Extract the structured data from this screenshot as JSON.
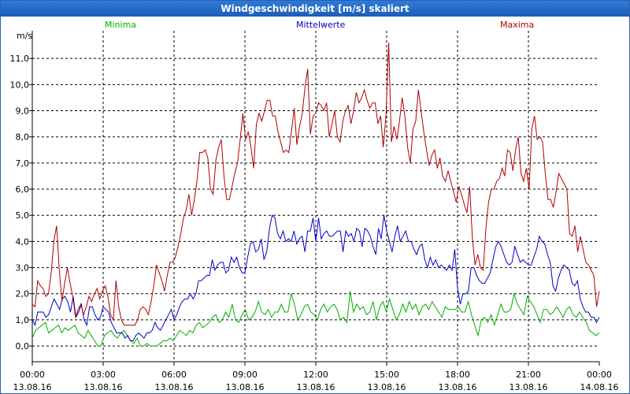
{
  "window": {
    "title": "Windgeschwindigkeit [m/s] skaliert"
  },
  "colors": {
    "minima": "#00b000",
    "mittel": "#0000cc",
    "maxima": "#b00000",
    "titlebar": "#1f62c0"
  },
  "chart_data": {
    "type": "line",
    "ylabel": "m/s",
    "ylim": [
      -0.6,
      12
    ],
    "grid": true,
    "legend_placement": "top",
    "yticks": [
      {
        "v": 0,
        "label": "0,0"
      },
      {
        "v": 1,
        "label": "1,0"
      },
      {
        "v": 2,
        "label": "2,0"
      },
      {
        "v": 3,
        "label": "3,0"
      },
      {
        "v": 4,
        "label": "4,0"
      },
      {
        "v": 5,
        "label": "5,0"
      },
      {
        "v": 6,
        "label": "6,0"
      },
      {
        "v": 7,
        "label": "7,0"
      },
      {
        "v": 8,
        "label": "8,0"
      },
      {
        "v": 9,
        "label": "9,0"
      },
      {
        "v": 10,
        "label": "10,0"
      },
      {
        "v": 11,
        "label": "11,0"
      }
    ],
    "xticks": [
      {
        "h": 0,
        "time": "00:00",
        "date": "13.08.16"
      },
      {
        "h": 3,
        "time": "03:00",
        "date": "13.08.16"
      },
      {
        "h": 6,
        "time": "06:00",
        "date": "13.08.16"
      },
      {
        "h": 9,
        "time": "09:00",
        "date": "13.08.16"
      },
      {
        "h": 12,
        "time": "12:00",
        "date": "13.08.16"
      },
      {
        "h": 15,
        "time": "15:00",
        "date": "13.08.16"
      },
      {
        "h": 18,
        "time": "18:00",
        "date": "13.08.16"
      },
      {
        "h": 21,
        "time": "21:00",
        "date": "13.08.16"
      },
      {
        "h": 24,
        "time": "00:00",
        "date": "14.08.16"
      }
    ],
    "x_hours_step": 0.1667,
    "series": [
      {
        "name": "Minima",
        "color": "#00b000",
        "values": [
          0.3,
          0.6,
          0.7,
          0.8,
          0.9,
          0.5,
          0.6,
          0.7,
          0.8,
          0.5,
          0.7,
          0.6,
          0.7,
          0.8,
          0.5,
          0.4,
          0.3,
          0.6,
          0.4,
          0.2,
          0.0,
          0.0,
          0.4,
          0.5,
          0.6,
          0.4,
          0.3,
          0.5,
          0.6,
          0.4,
          0.2,
          0.1,
          0.3,
          0.0,
          0.0,
          0.1,
          0.0,
          0.0,
          0.0,
          0.1,
          0.2,
          0.2,
          0.3,
          0.2,
          0.4,
          0.6,
          0.5,
          0.4,
          0.6,
          0.5,
          0.8,
          0.9,
          0.7,
          0.8,
          0.9,
          1.1,
          1.2,
          0.9,
          1.0,
          1.3,
          1.1,
          1.6,
          1.0,
          0.9,
          1.2,
          1.4,
          1.0,
          1.1,
          1.3,
          1.7,
          1.3,
          1.2,
          1.4,
          1.1,
          1.3,
          1.3,
          1.6,
          1.3,
          1.3,
          2.0,
          1.6,
          1.0,
          1.2,
          1.5,
          1.6,
          1.3,
          1.2,
          1.0,
          1.4,
          1.6,
          1.3,
          1.5,
          1.6,
          1.4,
          1.0,
          1.1,
          0.9,
          2.1,
          1.3,
          1.6,
          1.4,
          1.5,
          1.2,
          1.3,
          1.7,
          1.0,
          1.5,
          1.7,
          1.3,
          1.8,
          1.4,
          1.0,
          1.2,
          1.6,
          1.3,
          1.7,
          1.4,
          1.6,
          1.2,
          1.5,
          1.6,
          1.4,
          1.7,
          1.5,
          1.3,
          1.1,
          1.5,
          1.4,
          1.4,
          1.4,
          1.5,
          1.3,
          1.3,
          1.7,
          1.2,
          0.8,
          0.4,
          1.0,
          1.1,
          0.9,
          1.2,
          0.8,
          1.2,
          1.6,
          1.3,
          1.3,
          1.4,
          2.0,
          1.6,
          1.4,
          1.2,
          1.9,
          1.7,
          1.5,
          1.2,
          0.9,
          1.4,
          1.4,
          1.2,
          1.3,
          1.5,
          1.3,
          1.1,
          1.4,
          1.5,
          1.2,
          1.1,
          1.3,
          1.1,
          0.9,
          0.6,
          0.5,
          0.4,
          0.5
        ]
      },
      {
        "name": "Mittelwerte",
        "color": "#0000cc",
        "values": [
          1.0,
          0.8,
          1.3,
          1.3,
          1.3,
          1.1,
          1.2,
          1.5,
          1.8,
          1.6,
          1.4,
          1.8,
          1.9,
          1.7,
          1.3,
          1.9,
          1.1,
          1.3,
          1.6,
          1.0,
          0.8,
          1.5,
          1.5,
          1.2,
          1.0,
          1.1,
          1.5,
          1.4,
          1.3,
          0.9,
          0.7,
          0.5,
          0.5,
          0.5,
          0.3,
          0.4,
          0.2,
          0.2,
          0.4,
          0.5,
          0.4,
          0.3,
          0.5,
          0.5,
          0.6,
          0.9,
          0.7,
          0.6,
          0.8,
          1.0,
          1.2,
          1.4,
          1.0,
          1.2,
          1.5,
          1.7,
          1.8,
          1.8,
          2.0,
          1.8,
          2.0,
          2.5,
          2.5,
          2.6,
          2.7,
          2.7,
          3.3,
          2.9,
          3.1,
          3.2,
          3.2,
          2.8,
          2.9,
          3.4,
          3.2,
          3.4,
          3.0,
          2.8,
          2.8,
          3.4,
          3.9,
          4.0,
          3.6,
          3.7,
          4.1,
          3.3,
          3.6,
          4.5,
          5.0,
          4.9,
          4.3,
          4.1,
          4.4,
          4.0,
          4.1,
          4.0,
          4.4,
          3.9,
          4.1,
          4.2,
          3.6,
          4.4,
          4.4,
          4.9,
          4.0,
          4.9,
          4.1,
          4.3,
          4.4,
          4.2,
          4.2,
          4.3,
          4.4,
          4.4,
          3.6,
          4.4,
          4.2,
          4.3,
          4.0,
          4.5,
          4.4,
          3.8,
          4.5,
          4.4,
          4.2,
          3.8,
          3.5,
          4.5,
          4.1,
          5.0,
          4.4,
          4.0,
          3.6,
          4.2,
          4.6,
          4.0,
          4.2,
          4.4,
          4.0,
          4.0,
          3.7,
          3.5,
          3.8,
          3.9,
          3.3,
          3.0,
          3.4,
          3.1,
          3.3,
          3.0,
          3.1,
          3.0,
          2.9,
          3.1,
          2.9,
          3.7,
          2.2,
          1.6,
          2.0,
          2.0,
          2.1,
          3.0,
          3.0,
          2.7,
          2.5,
          2.4,
          2.4,
          2.6,
          2.8,
          3.3,
          3.8,
          4.0,
          3.8,
          3.5,
          3.2,
          3.1,
          3.2,
          3.8,
          3.5,
          3.2,
          3.3,
          3.2,
          3.1,
          3.1,
          3.4,
          3.7,
          4.2,
          4.0,
          3.9,
          3.5,
          3.2,
          2.3,
          2.1,
          2.6,
          2.9,
          3.1,
          3.0,
          2.9,
          2.4,
          2.3,
          2.5,
          1.8,
          1.5,
          1.3,
          1.3,
          1.1,
          1.1,
          0.9,
          1.1
        ]
      },
      {
        "name": "Maxima",
        "color": "#b00000",
        "values": [
          1.6,
          1.5,
          2.5,
          2.3,
          2.2,
          1.9,
          2.0,
          2.8,
          4.0,
          4.6,
          2.9,
          1.7,
          2.4,
          3.0,
          2.4,
          1.9,
          1.1,
          1.4,
          1.6,
          1.2,
          1.5,
          1.9,
          1.7,
          2.0,
          2.2,
          1.8,
          2.1,
          2.3,
          1.9,
          1.2,
          1.0,
          2.5,
          1.5,
          1.0,
          0.8,
          0.8,
          0.8,
          0.8,
          0.8,
          1.0,
          1.4,
          1.5,
          1.4,
          1.2,
          1.7,
          2.3,
          3.1,
          2.8,
          2.5,
          2.1,
          2.7,
          3.2,
          3.2,
          3.4,
          3.8,
          4.3,
          4.9,
          5.2,
          5.8,
          5.0,
          5.6,
          6.3,
          7.4,
          7.4,
          7.5,
          7.2,
          6.0,
          5.8,
          7.1,
          7.6,
          7.9,
          6.5,
          5.6,
          5.6,
          6.1,
          6.6,
          7.0,
          7.9,
          8.9,
          7.9,
          8.2,
          7.6,
          6.8,
          8.5,
          8.9,
          8.6,
          9.0,
          9.4,
          9.4,
          8.8,
          8.8,
          8.2,
          7.8,
          7.4,
          7.5,
          7.4,
          8.2,
          9.1,
          7.7,
          8.4,
          8.9,
          9.9,
          10.6,
          8.1,
          8.8,
          8.9,
          9.3,
          9.2,
          9.0,
          9.3,
          8.0,
          8.5,
          9.0,
          8.0,
          7.8,
          8.6,
          9.0,
          9.2,
          8.5,
          9.0,
          9.7,
          9.3,
          9.5,
          9.8,
          9.4,
          9.1,
          9.3,
          9.3,
          8.5,
          8.8,
          7.6,
          8.8,
          11.6,
          7.8,
          8.4,
          7.9,
          8.6,
          9.5,
          8.8,
          7.6,
          7.0,
          8.3,
          8.6,
          9.8,
          9.0,
          8.2,
          7.5,
          6.9,
          7.3,
          7.5,
          6.8,
          7.2,
          6.5,
          6.3,
          6.7,
          6.3,
          5.9,
          5.5,
          6.1,
          5.8,
          5.4,
          5.1,
          6.1,
          4.1,
          3.1,
          3.5,
          3.0,
          2.9,
          4.5,
          5.5,
          6.0,
          6.0,
          6.3,
          6.4,
          6.8,
          6.5,
          7.5,
          7.4,
          6.7,
          7.5,
          8.0,
          6.6,
          6.3,
          6.8,
          6.0,
          8.3,
          8.8,
          7.9,
          8.0,
          7.8,
          6.6,
          5.6,
          5.6,
          5.3,
          5.9,
          6.6,
          6.4,
          6.2,
          6.0,
          4.3,
          4.2,
          4.6,
          3.6,
          4.2,
          3.7,
          3.2,
          3.1,
          2.9,
          2.7,
          1.5,
          2.1
        ]
      }
    ]
  }
}
